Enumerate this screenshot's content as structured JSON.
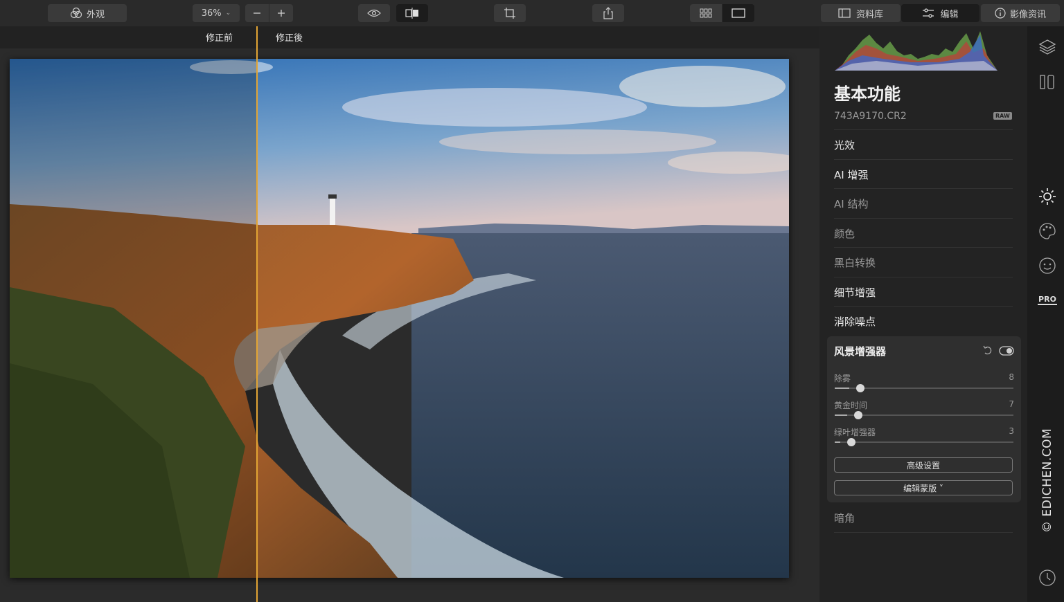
{
  "toolbar": {
    "looks_label": "外观",
    "zoom_value": "36%",
    "tabs": {
      "library": "资料库",
      "edit": "编辑",
      "info": "影像资讯"
    }
  },
  "compare": {
    "before_label": "修正前",
    "after_label": "修正後"
  },
  "panel": {
    "title": "基本功能",
    "filename": "743A9170.CR2",
    "raw_badge": "RAW",
    "sections": {
      "light": "光效",
      "ai_enhance": "AI 增强",
      "ai_structure": "AI 结构",
      "color": "颜色",
      "bw": "黑白转换",
      "detail": "细节增强",
      "denoise": "消除噪点",
      "vignette": "暗角"
    },
    "landscape": {
      "title": "风景增强器",
      "sliders": [
        {
          "label": "除雾",
          "value": "8",
          "fraction": 0.08
        },
        {
          "label": "黄金时间",
          "value": "7",
          "fraction": 0.07
        },
        {
          "label": "绿叶增强器",
          "value": "3",
          "fraction": 0.03
        }
      ],
      "advanced_button": "高级设置",
      "mask_button": "编辑蒙版 ˅"
    }
  },
  "rail": {
    "pro_label": "PRO"
  },
  "watermark": "© EDICHEN.COM",
  "colors": {
    "accent_divider": "#e3a534",
    "panel_bg": "#232323",
    "toolbar_bg": "#2a2a2a"
  }
}
